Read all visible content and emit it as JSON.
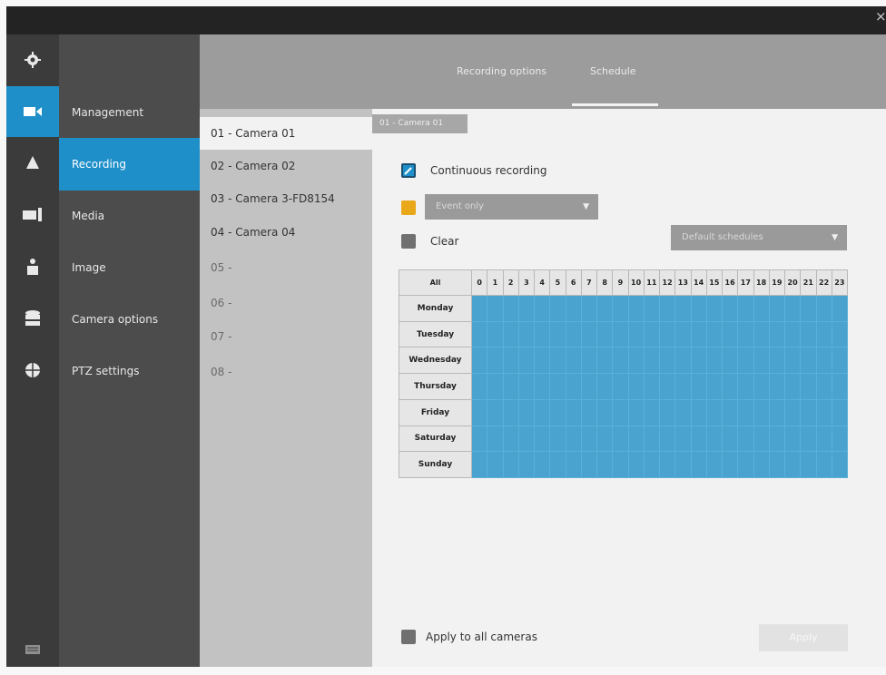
{
  "window": {
    "close_label": "×"
  },
  "rail": {
    "icons": [
      "gear-icon",
      "camera-icon",
      "alarm-icon",
      "monitor-icon",
      "user-icon",
      "storage-icon",
      "globe-icon",
      "keyboard-icon"
    ]
  },
  "menu": {
    "items": [
      {
        "label": "Management"
      },
      {
        "label": "Recording"
      },
      {
        "label": "Media"
      },
      {
        "label": "Image"
      },
      {
        "label": "Camera options"
      },
      {
        "label": "PTZ settings"
      }
    ]
  },
  "tabs": {
    "recording_options": "Recording options",
    "schedule": "Schedule"
  },
  "cameras": [
    {
      "label": "01 - Camera 01"
    },
    {
      "label": "02 - Camera 02"
    },
    {
      "label": "03 - Camera 3-FD8154"
    },
    {
      "label": "04 - Camera 04"
    },
    {
      "label": "05 -"
    },
    {
      "label": "06 -"
    },
    {
      "label": "07 -"
    },
    {
      "label": "08 -"
    }
  ],
  "content": {
    "breadcrumb": "01 - Camera 01",
    "continuous_label": "Continuous recording",
    "event_dropdown": "Event only",
    "clear_label": "Clear",
    "default_schedules": "Default schedules",
    "apply_all_label": "Apply to all cameras",
    "apply_button": "Apply"
  },
  "schedule": {
    "all_label": "All",
    "hours": [
      "0",
      "1",
      "2",
      "3",
      "4",
      "5",
      "6",
      "7",
      "8",
      "9",
      "10",
      "11",
      "12",
      "13",
      "14",
      "15",
      "16",
      "17",
      "18",
      "19",
      "20",
      "21",
      "22",
      "23"
    ],
    "days": [
      "Monday",
      "Tuesday",
      "Wednesday",
      "Thursday",
      "Friday",
      "Saturday",
      "Sunday"
    ]
  },
  "colors": {
    "accent": "#1f8fc9",
    "schedule_fill": "#4aa3cf",
    "event_marker": "#e8a81a"
  }
}
